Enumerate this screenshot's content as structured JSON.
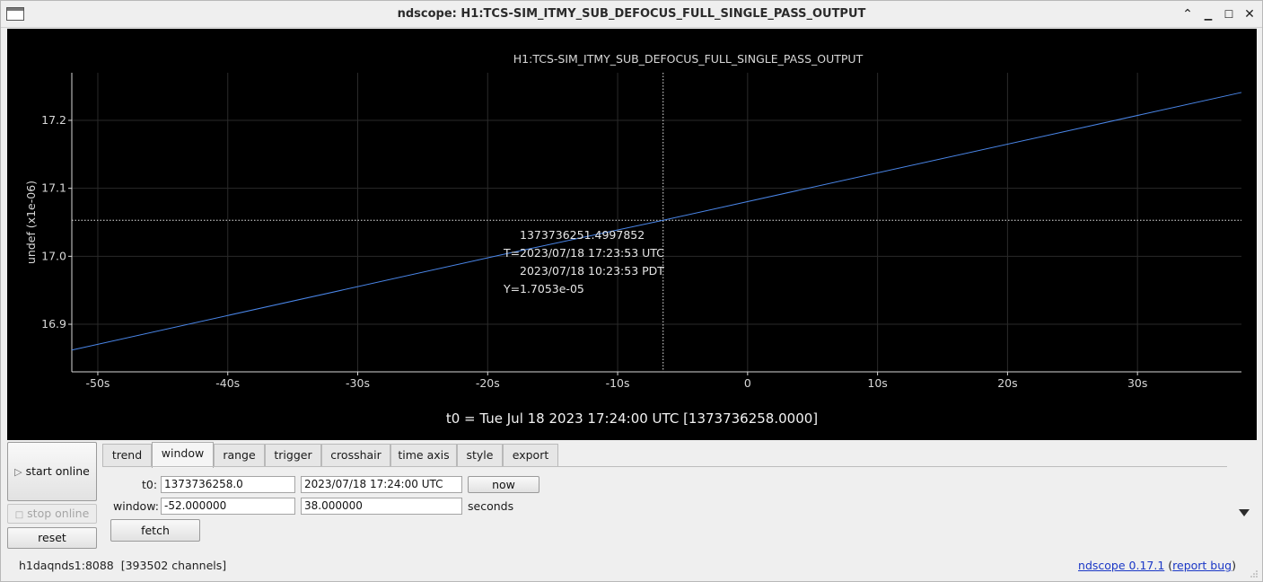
{
  "window": {
    "title": "ndscope: H1:TCS-SIM_ITMY_SUB_DEFOCUS_FULL_SINGLE_PASS_OUTPUT",
    "icon": "app-window-icon",
    "controls": {
      "minimize_icon": "▁",
      "maximize_icon": "□",
      "close_icon": "✕",
      "shade_icon": "⌃"
    }
  },
  "plot": {
    "title": "H1:TCS-SIM_ITMY_SUB_DEFOCUS_FULL_SINGLE_PASS_OUTPUT",
    "t0_label": "t0 = Tue Jul 18 2023 17:24:00 UTC [1373736258.0000]",
    "crosshair": {
      "gps": "1373736251.4997852",
      "t_prefix": "T=",
      "utc": "2023/07/18 17:23:53 UTC",
      "pdt": "2023/07/18 10:23:53 PDT",
      "y_prefix": "Y=",
      "y_value": "1.7053e-05",
      "x_value_s": -6.5,
      "y_value_units": 17.053
    }
  },
  "chart_data": {
    "type": "line",
    "title": "H1:TCS-SIM_ITMY_SUB_DEFOCUS_FULL_SINGLE_PASS_OUTPUT",
    "xlabel": "",
    "ylabel": "undef (x1e-06)",
    "x_ticks": [
      "-50s",
      "-40s",
      "-30s",
      "-20s",
      "-10s",
      "0",
      "10s",
      "20s",
      "30s"
    ],
    "x_tick_values": [
      -50,
      -40,
      -30,
      -20,
      -10,
      0,
      10,
      20,
      30
    ],
    "y_ticks": [
      "16.9",
      "17.0",
      "17.1",
      "17.2"
    ],
    "y_tick_values": [
      16.9,
      17.0,
      17.1,
      17.2
    ],
    "xlim": [
      -52,
      38
    ],
    "ylim": [
      16.83,
      17.27
    ],
    "grid": true,
    "colors": {
      "background": "#000000",
      "line": "#4a86e8",
      "grid": "#2a2a2a",
      "axis": "#d8d8d8",
      "crosshair": "#e6e6e6"
    },
    "series": [
      {
        "x": [
          -52,
          -19,
          -6.5,
          38
        ],
        "y": [
          16.862,
          17.002,
          17.053,
          17.241
        ]
      }
    ]
  },
  "controls": {
    "start_online": "start online",
    "start_online_icon": "▷",
    "stop_online": "stop online",
    "stop_online_icon": "□",
    "reset": "reset",
    "fetch": "fetch",
    "now": "now"
  },
  "tabs": [
    "trend",
    "window",
    "range",
    "trigger",
    "crosshair",
    "time axis",
    "style",
    "export"
  ],
  "active_tab": "window",
  "window_tab": {
    "t0_label": "t0:",
    "t0_gps": "1373736258.0",
    "t0_utc": "2023/07/18 17:24:00 UTC",
    "window_label": "window:",
    "window_start": "-52.000000",
    "window_end": "38.000000",
    "window_units": "seconds"
  },
  "status": {
    "server": "h1daqnds1:8088",
    "channels": "[393502 channels]",
    "version_link": "ndscope 0.17.1",
    "report_link": "report bug",
    "open_paren": "(",
    "close_paren": ")"
  },
  "collapse_icon": "triangle-down-icon"
}
